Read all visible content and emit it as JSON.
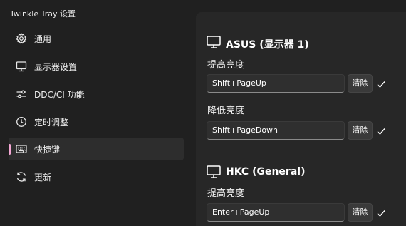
{
  "window": {
    "title": "Twinkle Tray 设置"
  },
  "sidebar": {
    "items": [
      {
        "label": "通用",
        "icon": "gear-icon"
      },
      {
        "label": "显示器设置",
        "icon": "monitor-icon"
      },
      {
        "label": "DDC/CI 功能",
        "icon": "sliders-icon"
      },
      {
        "label": "定时调整",
        "icon": "clock-icon"
      },
      {
        "label": "快捷键",
        "icon": "keyboard-icon",
        "active": true
      },
      {
        "label": "更新",
        "icon": "refresh-icon"
      }
    ]
  },
  "monitors": [
    {
      "name": "ASUS (显示器 1)",
      "hotkeys": [
        {
          "label": "提高亮度",
          "value": "Shift+PageUp",
          "clear_label": "清除"
        },
        {
          "label": "降低亮度",
          "value": "Shift+PageDown",
          "clear_label": "清除"
        }
      ]
    },
    {
      "name": "HKC (General)",
      "hotkeys": [
        {
          "label": "提高亮度",
          "value": "Enter+PageUp",
          "clear_label": "清除"
        }
      ]
    }
  ],
  "colors": {
    "accent": "#f4a7d4",
    "background": "#202020",
    "panel": "#272727"
  }
}
